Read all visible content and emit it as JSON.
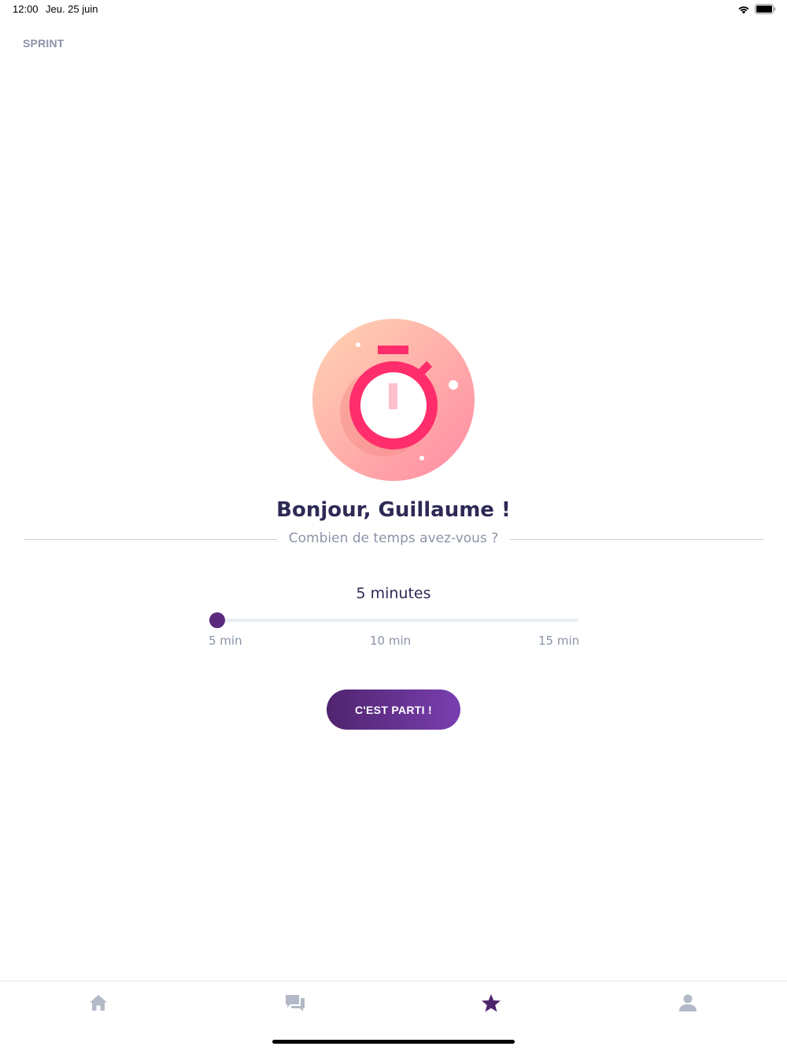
{
  "status_bar": {
    "time": "12:00",
    "date": "Jeu. 25 juin",
    "icons": [
      "wifi-icon",
      "battery-icon"
    ]
  },
  "header": {
    "title": "SPRINT"
  },
  "illustration": {
    "icon": "stopwatch-icon"
  },
  "main": {
    "greeting": "Bonjour, Guillaume !",
    "question": "Combien de temps avez-vous ?",
    "duration_label": "5 minutes",
    "slider": {
      "min_label": "5 min",
      "mid_label": "10 min",
      "max_label": "15 min",
      "value_minutes": 5,
      "range_minutes": [
        5,
        15
      ]
    },
    "cta_label": "C'EST PARTI !"
  },
  "tab_bar": {
    "tabs": [
      {
        "icon": "home-icon",
        "active": false
      },
      {
        "icon": "chat-icon",
        "active": false
      },
      {
        "icon": "star-icon",
        "active": true
      },
      {
        "icon": "user-icon",
        "active": false
      }
    ]
  },
  "colors": {
    "accent": "#5a2a7c",
    "accent_gradient_end": "#7a3fb0",
    "stopwatch": "#ff2d6b",
    "text_primary": "#2d2a55",
    "text_secondary": "#8a94a7",
    "tab_inactive": "#b3b9c6"
  }
}
